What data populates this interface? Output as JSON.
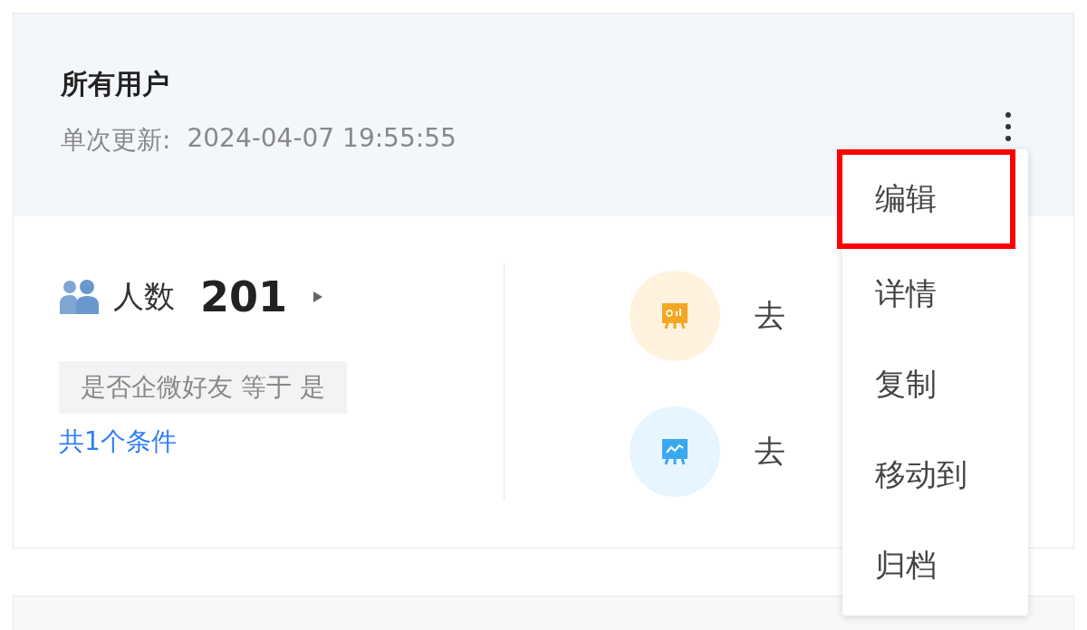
{
  "card": {
    "title": "所有用户",
    "update_label": "单次更新:",
    "update_time": "2024-04-07 19:55:55",
    "count_label": "人数",
    "count": "201",
    "condition": "是否企微好友 等于 是",
    "condition_link": "共1个条件",
    "actions": [
      {
        "kind": "report",
        "label": "去"
      },
      {
        "kind": "analysis",
        "label": "去"
      }
    ]
  },
  "menu": [
    {
      "label": "编辑",
      "selected": true
    },
    {
      "label": "详情",
      "selected": false
    },
    {
      "label": "复制",
      "selected": false
    },
    {
      "label": "移动到",
      "selected": false
    },
    {
      "label": "归档",
      "selected": false
    }
  ]
}
